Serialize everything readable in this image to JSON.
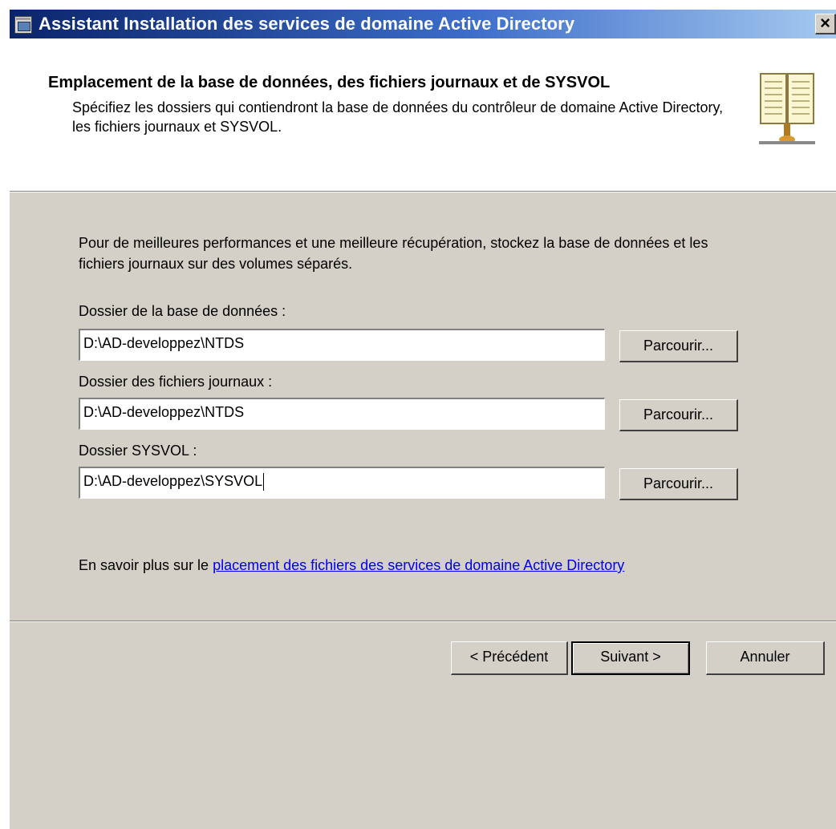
{
  "window": {
    "title": "Assistant Installation des services de domaine Active Directory",
    "close_glyph": "✕"
  },
  "header": {
    "title": "Emplacement de la base de données, des fichiers journaux et de SYSVOL",
    "description": "Spécifiez les dossiers qui contiendront la base de données du contrôleur de domaine Active Directory, les fichiers journaux et SYSVOL.",
    "icon": "book-icon"
  },
  "content": {
    "intro": "Pour de meilleures performances et une meilleure récupération, stockez la base de données et les fichiers journaux sur des volumes séparés.",
    "fields": [
      {
        "label": "Dossier de la base de données :",
        "value": "D:\\AD-developpez\\NTDS",
        "button": "Parcourir..."
      },
      {
        "label": "Dossier des fichiers journaux :",
        "value": "D:\\AD-developpez\\NTDS",
        "button": "Parcourir..."
      },
      {
        "label": "Dossier SYSVOL :",
        "value": "D:\\AD-developpez\\SYSVOL",
        "button": "Parcourir..."
      }
    ],
    "learn_more_prefix": "En savoir plus sur le ",
    "learn_more_link": "placement des fichiers des services de domaine Active Directory"
  },
  "footer": {
    "back_label": "< Précédent",
    "next_label": "Suivant >",
    "cancel_label": "Annuler"
  }
}
